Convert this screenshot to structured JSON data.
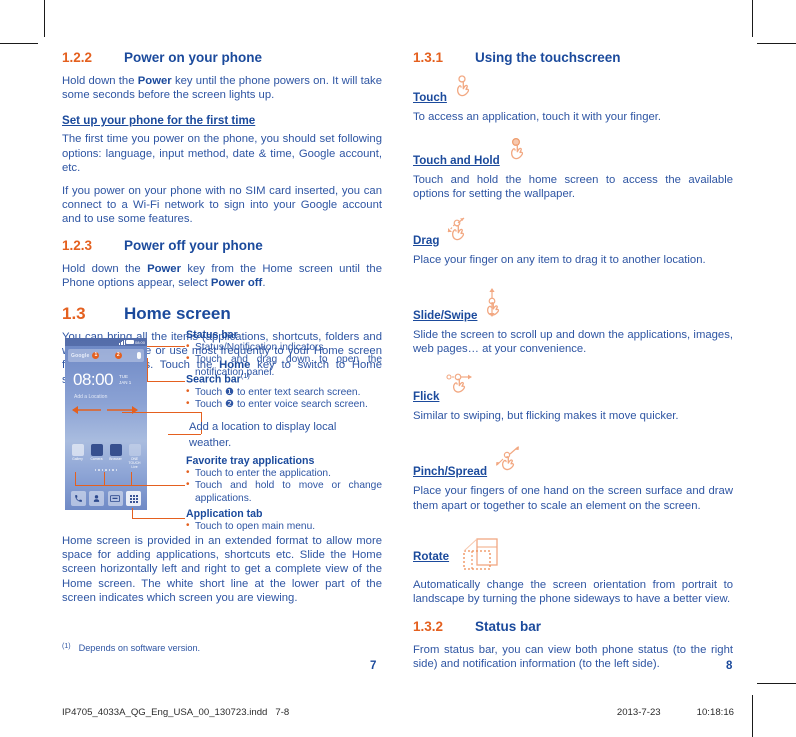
{
  "document": {
    "left_page_number": "7",
    "right_page_number": "8",
    "footnote_marker": "(1)",
    "footnote_text": "Depends on software version.",
    "print_filename": "IP4705_4033A_QG_Eng_USA_00_130723.indd   7-8",
    "print_date": "2013-7-23",
    "print_time": "10:18:16"
  },
  "colors": {
    "heading_orange": "#E4601F",
    "heading_blue": "#1B4A9C",
    "body_blue": "#2E55A3"
  },
  "left": {
    "s122": {
      "num": "1.2.2",
      "title": "Power on your phone",
      "p1": "Hold down the ",
      "p1_bold": "Power",
      "p1_rest": " key until the phone powers on. It will take some seconds before the screen lights up.",
      "sub1": "Set up your phone for the first time",
      "p2": "The first time you power on the phone, you should set following options: language, input method, date & time, Google account, etc.",
      "p3": "If you power on your phone with no SIM card inserted, you can connect to a Wi-Fi network to sign into your Google account and to use some features."
    },
    "s123": {
      "num": "1.2.3",
      "title": "Power off your phone",
      "p1": "Hold down the ",
      "p1_bold": "Power",
      "p1_mid": " key from the Home screen until the Phone options appear, select ",
      "p1_bold2": "Power off",
      "p1_end": "."
    },
    "s13": {
      "num": "1.3",
      "title": "Home screen",
      "p1a": "You can bring all the items (applications, shortcuts, folders and widgets) you love or use most frequently to your Home screen for quick access. Touch the ",
      "p1_bold": "Home",
      "p1b": " key to switch to Home screen.",
      "p2": "Home screen is provided in an extended format to allow more space for adding applications, shortcuts etc. Slide the Home screen horizontally left and right to get a complete view of the Home screen. The white short line at the lower part of the screen indicates which screen you are viewing."
    },
    "callouts": [
      {
        "title": "Status bar",
        "items": [
          "Status/Notification indicators",
          "Touch and drag down to open the notification panel."
        ]
      },
      {
        "title": "Search bar",
        "title_sup": "(1)",
        "items": [
          "Touch ❶ to enter text search screen.",
          "Touch ❷ to enter voice search screen."
        ]
      },
      {
        "plain": "Add a location to display local weather."
      },
      {
        "title": "Favorite tray applications",
        "items": [
          "Touch to enter the application.",
          "Touch and hold to move or change applications."
        ]
      },
      {
        "title": "Application tab",
        "items": [
          "Touch to open main menu."
        ]
      }
    ],
    "phone": {
      "status_time": "08:00",
      "search_brand": "Google",
      "badge1": "1",
      "badge2": "2",
      "clock": "08:00",
      "day": "TUE",
      "date": "JAN 1",
      "location_hint": "Add a Location",
      "apps": [
        {
          "label": "Gallery"
        },
        {
          "label": "Camera"
        },
        {
          "label": "Browser"
        },
        {
          "label": "ONE TOUCH Live"
        }
      ],
      "tray": [
        "phone-icon",
        "contacts-icon",
        "messaging-icon",
        "app-tab-icon"
      ]
    }
  },
  "right": {
    "s131": {
      "num": "1.3.1",
      "title": "Using the touchscreen"
    },
    "gestures": [
      {
        "name": "Touch",
        "icon": "touch-hand-icon",
        "desc": "To access an application, touch it with your finger."
      },
      {
        "name": "Touch and Hold",
        "icon": "touch-hold-hand-icon",
        "desc": "Touch and hold the home screen to access the available options for setting the wallpaper."
      },
      {
        "name": "Drag",
        "icon": "drag-hand-icon",
        "desc": "Place your finger on any item to drag it to another location."
      },
      {
        "name": "Slide/Swipe",
        "icon": "slide-hand-icon",
        "desc": "Slide the screen to scroll up and down the applications, images, web pages… at your convenience."
      },
      {
        "name": "Flick",
        "icon": "flick-hand-icon",
        "desc": "Similar to swiping, but flicking makes it move quicker."
      },
      {
        "name": "Pinch/Spread",
        "icon": "pinch-spread-hand-icon",
        "desc": "Place your fingers of one hand on the screen surface and draw them apart or together to scale an element on the screen."
      },
      {
        "name": "Rotate",
        "icon": "rotate-screen-icon",
        "desc": "Automatically change the screen orientation from portrait to landscape by turning the phone sideways to have a better view."
      }
    ],
    "s132": {
      "num": "1.3.2",
      "title": "Status bar",
      "p1": "From status bar, you can view both phone status (to the right side) and notification information (to the left side)."
    }
  }
}
